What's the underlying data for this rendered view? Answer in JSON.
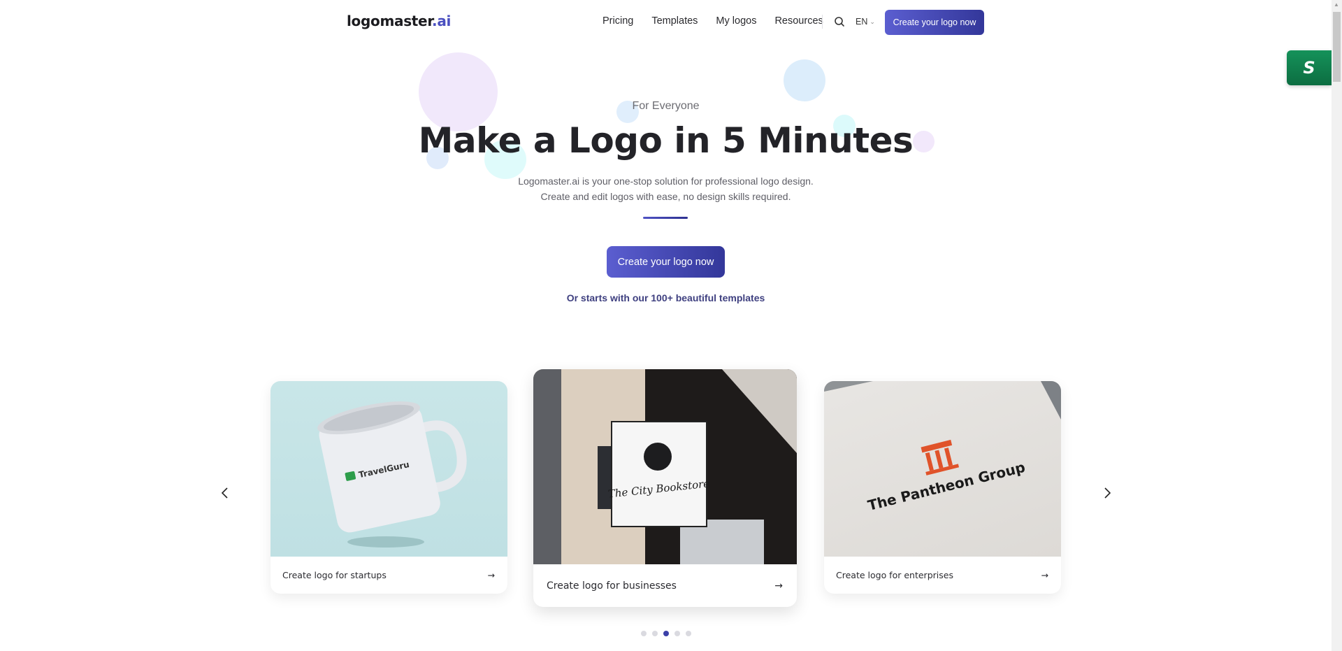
{
  "header": {
    "logo_main": "logomaster",
    "logo_suffix": ".ai",
    "nav": [
      {
        "label": "Pricing"
      },
      {
        "label": "Templates"
      },
      {
        "label": "My logos"
      },
      {
        "label": "Resources"
      }
    ],
    "search_icon": "search-icon",
    "language": "EN",
    "cta_label": "Create your logo now"
  },
  "floating_badge": {
    "letter": "S"
  },
  "hero": {
    "eyebrow": "For Everyone",
    "title": "Make a Logo in 5 Minutes",
    "description": "Logomaster.ai is your one-stop solution for professional logo design. Create and edit logos with ease, no design skills required.",
    "cta_label": "Create your logo now",
    "templates_link": "Or starts with our 100+ beautiful templates"
  },
  "carousel": {
    "prev_icon": "chevron-left-icon",
    "next_icon": "chevron-right-icon",
    "cards": [
      {
        "label": "Create logo for startups",
        "mockup": "TravelGuru",
        "arrow": "→"
      },
      {
        "label": "Create logo for businesses",
        "mockup": "The City Bookstore",
        "arrow": "→"
      },
      {
        "label": "Create logo for enterprises",
        "mockup": "The Pantheon Group",
        "arrow": "→"
      }
    ],
    "pagination": {
      "total": 5,
      "active_index": 2
    }
  },
  "colors": {
    "brand": "#4a4fc0",
    "cta_start": "#5b5ed0",
    "cta_end": "#33379a",
    "badge_green": "#12804d"
  }
}
